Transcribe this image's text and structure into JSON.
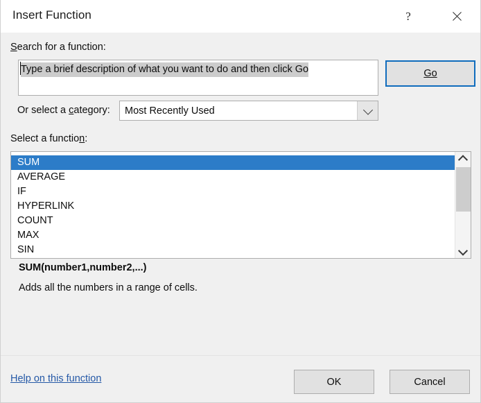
{
  "window": {
    "title": "Insert Function",
    "help_icon": "question-mark-icon",
    "close_icon": "close-icon"
  },
  "search": {
    "label": "Search for a function:",
    "value": "Type a brief description of what you want to do and then click Go",
    "placeholder": "Type a brief description of what you want to do and then click Go",
    "go_label": "Go",
    "selection_highlight_color": "#cccccc",
    "default_button_border_color": "#0f6cbd"
  },
  "category": {
    "label": "Or select a category:",
    "selected": "Most Recently Used",
    "arrow_icon": "chevron-down-icon",
    "options": [
      "Most Recently Used"
    ]
  },
  "function_list": {
    "label": "Select a function:",
    "selected": "SUM",
    "selection_color": "#2c7cc8",
    "items": [
      "SUM",
      "AVERAGE",
      "IF",
      "HYPERLINK",
      "COUNT",
      "MAX",
      "SIN"
    ],
    "scrollbar": {
      "up_icon": "chevron-up-icon",
      "down_icon": "chevron-down-icon",
      "thumb_color": "#cdcdcd"
    }
  },
  "description": {
    "signature": "SUM(number1,number2,...)",
    "text": "Adds all the numbers in a range of cells."
  },
  "footer": {
    "help_link": "Help on this function",
    "help_link_color": "#2458a6",
    "ok_label": "OK",
    "cancel_label": "Cancel"
  }
}
